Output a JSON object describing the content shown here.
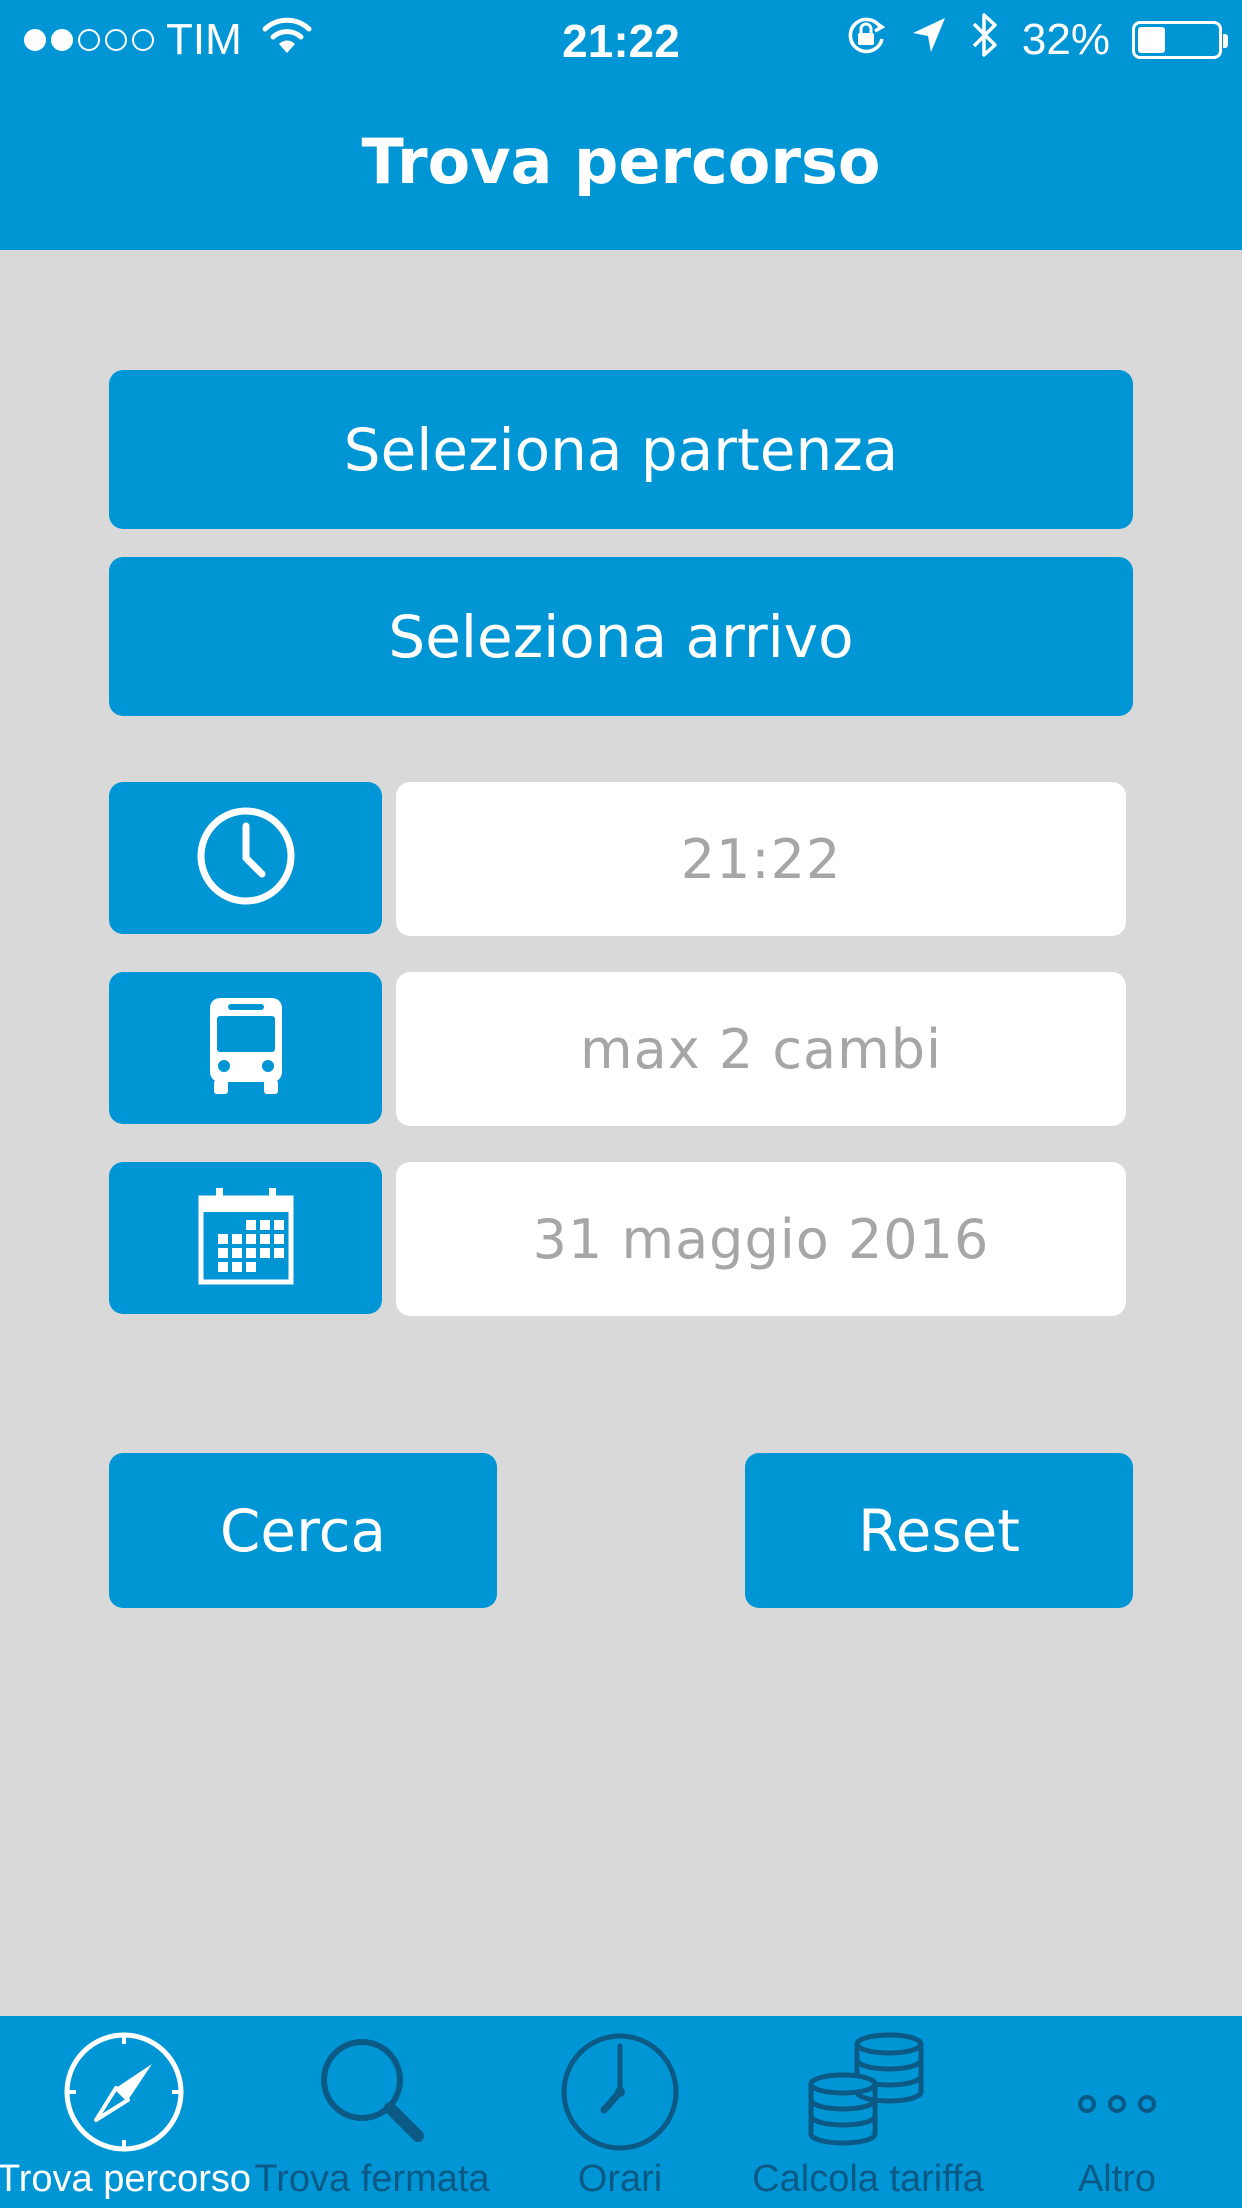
{
  "status_bar": {
    "carrier": "TIM",
    "signal_bars_filled": 2,
    "signal_bars_total": 5,
    "time": "21:22",
    "battery_percent": "32%",
    "battery_level": 0.32,
    "icons": [
      "wifi-icon",
      "rotation-lock-icon",
      "location-arrow-icon",
      "bluetooth-icon",
      "battery-icon"
    ]
  },
  "header": {
    "title": "Trova percorso"
  },
  "main": {
    "departure_button": "Seleziona partenza",
    "arrival_button": "Seleziona arrivo",
    "time_field": "21:22",
    "changes_field": "max 2 cambi",
    "date_field": "31 maggio 2016",
    "search_button": "Cerca",
    "reset_button": "Reset",
    "icons": [
      "clock-icon",
      "bus-icon",
      "calendar-icon"
    ]
  },
  "tab_bar": {
    "tabs": [
      {
        "label": "Trova percorso",
        "icon": "compass-icon",
        "active": true
      },
      {
        "label": "Trova fermata",
        "icon": "magnifier-icon",
        "active": false
      },
      {
        "label": "Orari",
        "icon": "clock-icon",
        "active": false
      },
      {
        "label": "Calcola tariffa",
        "icon": "coins-icon",
        "active": false
      },
      {
        "label": "Altro",
        "icon": "more-icon",
        "active": false
      }
    ]
  },
  "colors": {
    "primary": "#0096d6",
    "background": "#d9d9d9",
    "field_text": "#a6a6a6",
    "tab_inactive": "#0b5a86",
    "tab_active": "#ffffff"
  }
}
